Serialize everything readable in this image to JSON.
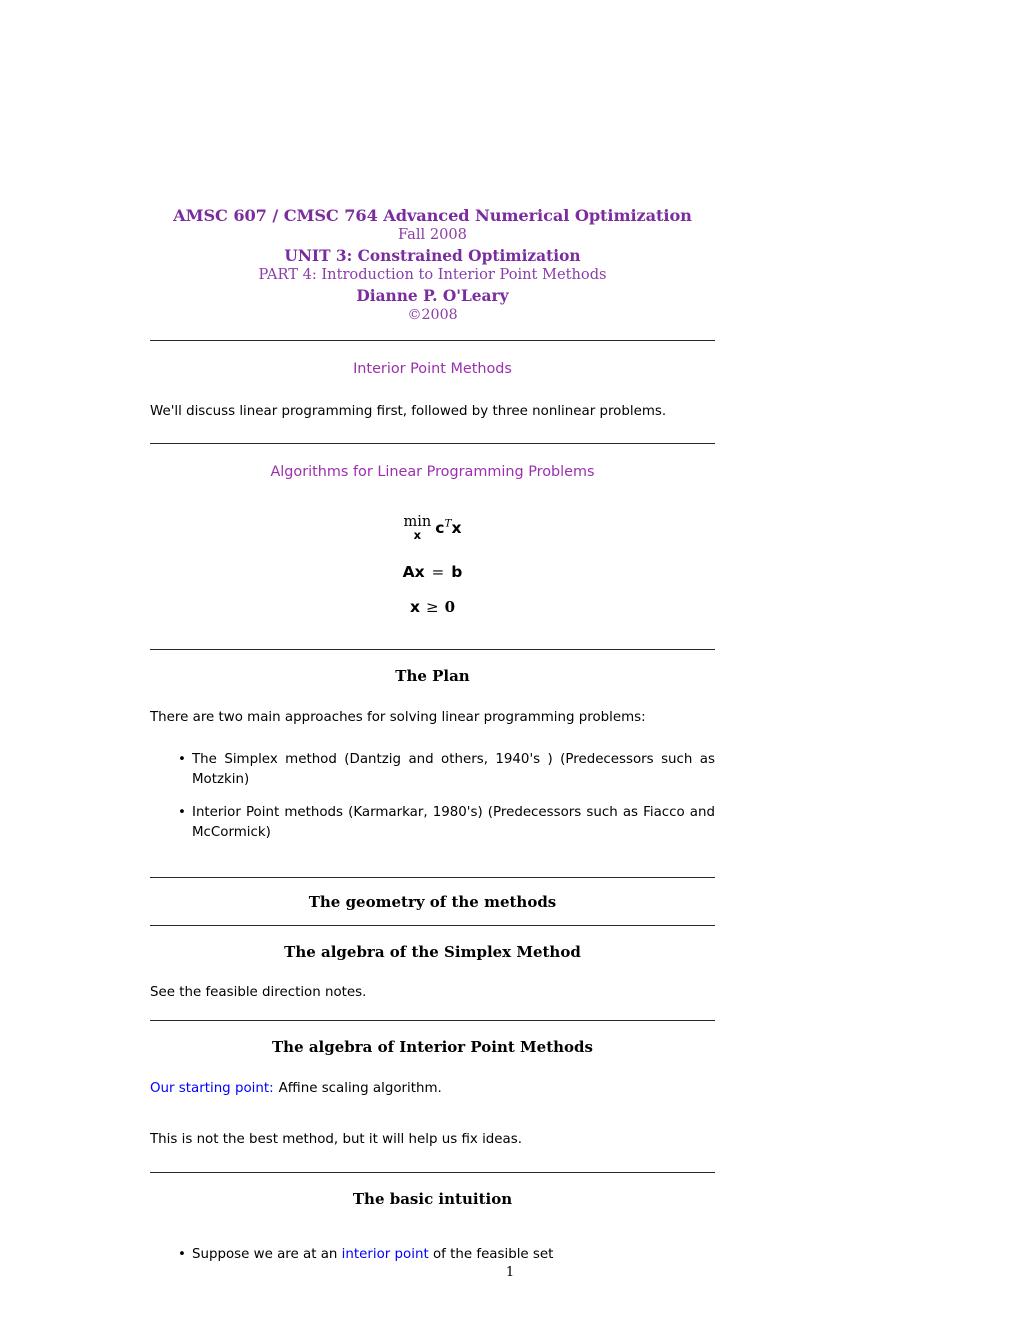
{
  "document": {
    "page_number": "1",
    "colors": {
      "title_purple": "#7B2C9E",
      "heading_magenta": "#9B2FAE",
      "emphasis_blue": "#0000FF",
      "rule_gray": "#2a2a2a",
      "text_black": "#000000"
    }
  },
  "title": {
    "course": "AMSC 607 / CMSC 764 Advanced Numerical Optimization",
    "term": "Fall 2008",
    "unit": "UNIT 3: Constrained Optimization",
    "part": "PART 4: Introduction to Interior Point Methods",
    "author": "Dianne P. O'Leary",
    "copyright": "©2008"
  },
  "sections": {
    "interior_point_methods": {
      "heading": "Interior Point Methods",
      "paragraph": "We'll discuss linear programming first, followed by three nonlinear problems."
    },
    "algorithms_lp": {
      "heading": "Algorithms for Linear Programming Problems",
      "equations": {
        "objective_min": "min",
        "objective_subscript": "x",
        "objective_c": "c",
        "objective_transpose": "T",
        "objective_x": "x",
        "constraint_A": "A",
        "constraint_x": "x",
        "constraint_equals": "=",
        "constraint_b": "b",
        "bound_x": "x",
        "bound_ge": "≥",
        "bound_zero": "0"
      }
    },
    "the_plan": {
      "heading": "The Plan",
      "paragraph": "There are two main approaches for solving linear programming problems:",
      "bullets": [
        "The Simplex method (Dantzig and others, 1940's ) (Predecessors such as Motzkin)",
        "Interior Point methods (Karmarkar, 1980's) (Predecessors such as Fiacco and McCormick)"
      ],
      "bullet_marker": "•"
    },
    "geometry": {
      "heading": "The geometry of the methods"
    },
    "algebra_simplex": {
      "heading": "The algebra of the Simplex Method",
      "paragraph": "See the feasible direction notes."
    },
    "algebra_interior_point": {
      "heading": "The algebra of Interior Point Methods",
      "starting_point_label": "Our starting point:",
      "starting_point_text": "Affine scaling algorithm.",
      "paragraph": "This is not the best method, but it will help us fix ideas."
    },
    "basic_intuition": {
      "heading": "The basic intuition",
      "bullet_marker": "•",
      "bullet_prefix": "Suppose we are at an ",
      "bullet_highlight": "interior point",
      "bullet_suffix": " of the feasible set"
    }
  }
}
